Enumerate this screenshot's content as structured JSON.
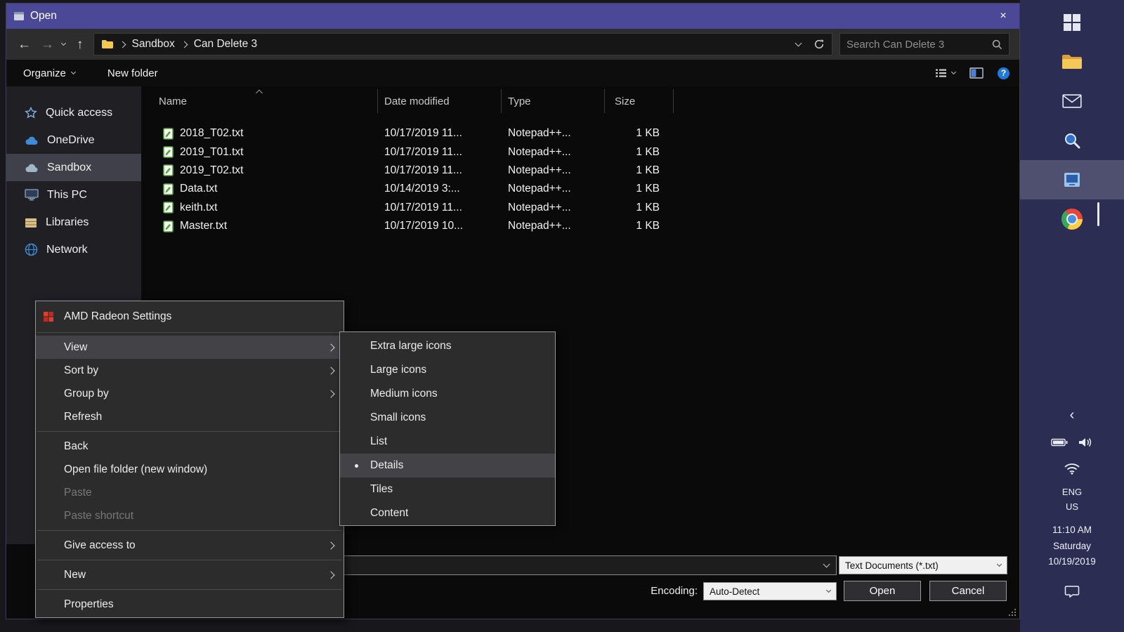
{
  "colors": {
    "titlebar": "#4b4997",
    "taskbar": "#2c2d52",
    "menu-bg": "#2c2c2c",
    "menu-highlight": "#434347",
    "selection": "#40404a",
    "accent-blue": "#2079d8"
  },
  "window": {
    "title": "Open",
    "close_glyph": "×"
  },
  "nav": {
    "breadcrumb": {
      "items": [
        "Sandbox",
        "Can Delete 3"
      ]
    },
    "search": {
      "placeholder": "Search Can Delete 3"
    }
  },
  "toolbar": {
    "organize_label": "Organize",
    "new_folder_label": "New folder"
  },
  "sidebar": {
    "items": [
      {
        "label": "Quick access",
        "icon": "star",
        "selected": false
      },
      {
        "label": "OneDrive",
        "icon": "cloud-blue",
        "selected": false
      },
      {
        "label": "Sandbox",
        "icon": "cloud-gray",
        "selected": true
      },
      {
        "label": "This PC",
        "icon": "pc",
        "selected": false
      },
      {
        "label": "Libraries",
        "icon": "library",
        "selected": false
      },
      {
        "label": "Network",
        "icon": "network",
        "selected": false
      }
    ]
  },
  "files": {
    "columns": [
      {
        "label": "Name",
        "sort": "asc"
      },
      {
        "label": "Date modified",
        "sort": null
      },
      {
        "label": "Type",
        "sort": null
      },
      {
        "label": "Size",
        "sort": null
      }
    ],
    "rows": [
      {
        "name": "2018_T02.txt",
        "date": "10/17/2019 11...",
        "type": "Notepad++...",
        "size": "1 KB"
      },
      {
        "name": "2019_T01.txt",
        "date": "10/17/2019 11...",
        "type": "Notepad++...",
        "size": "1 KB"
      },
      {
        "name": "2019_T02.txt",
        "date": "10/17/2019 11...",
        "type": "Notepad++...",
        "size": "1 KB"
      },
      {
        "name": "Data.txt",
        "date": "10/14/2019 3:...",
        "type": "Notepad++...",
        "size": "1 KB"
      },
      {
        "name": "keith.txt",
        "date": "10/17/2019 11...",
        "type": "Notepad++...",
        "size": "1 KB"
      },
      {
        "name": "Master.txt",
        "date": "10/17/2019 10...",
        "type": "Notepad++...",
        "size": "1 KB"
      }
    ]
  },
  "context_menu": {
    "items": [
      {
        "type": "item",
        "label": "AMD Radeon Settings",
        "icon": "amd-radeon",
        "disabled": false,
        "submenu": false,
        "highlighted": false
      },
      {
        "type": "separator"
      },
      {
        "type": "item",
        "label": "View",
        "disabled": false,
        "submenu": true,
        "highlighted": true
      },
      {
        "type": "item",
        "label": "Sort by",
        "disabled": false,
        "submenu": true,
        "highlighted": false
      },
      {
        "type": "item",
        "label": "Group by",
        "disabled": false,
        "submenu": true,
        "highlighted": false
      },
      {
        "type": "item",
        "label": "Refresh",
        "disabled": false,
        "submenu": false,
        "highlighted": false
      },
      {
        "type": "separator"
      },
      {
        "type": "item",
        "label": "Back",
        "disabled": false,
        "submenu": false,
        "highlighted": false
      },
      {
        "type": "item",
        "label": "Open file folder (new window)",
        "disabled": false,
        "submenu": false,
        "highlighted": false
      },
      {
        "type": "item",
        "label": "Paste",
        "disabled": true,
        "submenu": false,
        "highlighted": false
      },
      {
        "type": "item",
        "label": "Paste shortcut",
        "disabled": true,
        "submenu": false,
        "highlighted": false
      },
      {
        "type": "separator"
      },
      {
        "type": "item",
        "label": "Give access to",
        "disabled": false,
        "submenu": true,
        "highlighted": false
      },
      {
        "type": "separator"
      },
      {
        "type": "item",
        "label": "New",
        "disabled": false,
        "submenu": true,
        "highlighted": false
      },
      {
        "type": "separator"
      },
      {
        "type": "item",
        "label": "Properties",
        "disabled": false,
        "submenu": false,
        "highlighted": false
      }
    ]
  },
  "view_submenu": {
    "items": [
      {
        "label": "Extra large icons",
        "selected": false,
        "highlighted": false
      },
      {
        "label": "Large icons",
        "selected": false,
        "highlighted": false
      },
      {
        "label": "Medium icons",
        "selected": false,
        "highlighted": false
      },
      {
        "label": "Small icons",
        "selected": false,
        "highlighted": false
      },
      {
        "label": "List",
        "selected": false,
        "highlighted": false
      },
      {
        "label": "Details",
        "selected": true,
        "highlighted": true
      },
      {
        "label": "Tiles",
        "selected": false,
        "highlighted": false
      },
      {
        "label": "Content",
        "selected": false,
        "highlighted": false
      }
    ]
  },
  "footer": {
    "filename": {
      "value": ""
    },
    "filetype": {
      "value": "Text Documents (*.txt)"
    },
    "encoding": {
      "label": "Encoding:",
      "value": "Auto-Detect"
    },
    "open_label": "Open",
    "cancel_label": "Cancel"
  },
  "taskbar": {
    "apps": [
      {
        "name": "start",
        "icon": "windows",
        "active": false
      },
      {
        "name": "file-explorer",
        "icon": "explorer-folder",
        "active": false
      },
      {
        "name": "mail",
        "icon": "mail",
        "active": false
      },
      {
        "name": "search",
        "icon": "magnifier-blue",
        "active": false
      },
      {
        "name": "active-app",
        "icon": "blue-app",
        "active": true
      },
      {
        "name": "chrome",
        "icon": "chrome",
        "active": false
      }
    ],
    "tray": {
      "language": "ENG",
      "region": "US",
      "time": "11:10 AM",
      "day": "Saturday",
      "date": "10/19/2019"
    }
  }
}
